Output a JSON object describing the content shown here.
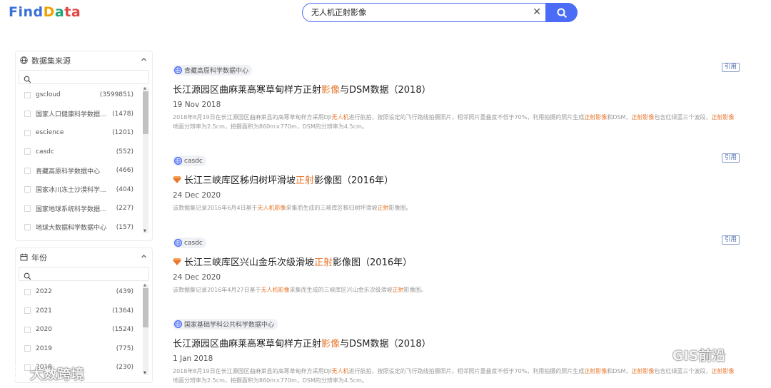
{
  "logo": {
    "part1": "Find",
    "part2": "D",
    "part3": "a",
    "part4": "ta"
  },
  "search": {
    "query": "无人机正射影像",
    "placeholder": ""
  },
  "sources_panel": {
    "title": "数据集来源",
    "items": [
      {
        "label": "gscloud",
        "count": "(3599851)"
      },
      {
        "label": "国家人口健康科学数据...",
        "count": "(1478)"
      },
      {
        "label": "escience",
        "count": "(1201)"
      },
      {
        "label": "casdc",
        "count": "(552)"
      },
      {
        "label": "青藏高原科学数据中心",
        "count": "(466)"
      },
      {
        "label": "国家冰川冻土沙漠科学...",
        "count": "(404)"
      },
      {
        "label": "国家地球系统科学数据...",
        "count": "(227)"
      },
      {
        "label": "地球大数据科学数据中心",
        "count": "(157)"
      }
    ]
  },
  "year_panel": {
    "title": "年份",
    "items": [
      {
        "label": "2022",
        "count": "(439)"
      },
      {
        "label": "2021",
        "count": "(1364)"
      },
      {
        "label": "2020",
        "count": "(1524)"
      },
      {
        "label": "2019",
        "count": "(775)"
      },
      {
        "label": "2018",
        "count": "(230)"
      }
    ]
  },
  "results": [
    {
      "source": "青藏高原科学数据中心",
      "cite": "引用",
      "title_pre": "长江源园区曲麻莱高寒草甸样方正射",
      "title_hl": "影像",
      "title_post": "与DSM数据（2018）",
      "date": "19 Nov 2018",
      "desc_1": "2018年8月19日在长江源园区曲麻莱县的高寒草甸样方采用DJI",
      "desc_hl1": "无人机",
      "desc_2": "进行航拍，按照设定的飞行路线拍摄照片，相邻照片重叠度不低于70%，利用拍摄的照片生成",
      "desc_hl2": "正射影像",
      "desc_3": "和DSM，",
      "desc_hl3": "正射影像",
      "desc_4": "包含红绿蓝三个波段，",
      "desc_hl4": "正射影像",
      "desc_5": "地面分辨率为2.5cm，拍摄面积为860m×770m，DSM的分辨率为4.5cm。"
    },
    {
      "source": "casdc",
      "cite": "引用",
      "title_pre": "长江三峡库区秭归树坪滑坡",
      "title_hl": "正射",
      "title_post": "影像图（2016年）",
      "date": "24 Dec 2020",
      "desc_1": "该数据集记录2016年6月4日基于",
      "desc_hl1": "无人机影像",
      "desc_2": "采集而生成的三峡库区秭归树坪滑坡",
      "desc_hl2": "正射",
      "desc_3": "影像图。"
    },
    {
      "source": "casdc",
      "cite": "引用",
      "title_pre": "长江三峡库区兴山金乐次级滑坡",
      "title_hl": "正射",
      "title_post": "影像图（2016年）",
      "date": "24 Dec 2020",
      "desc_1": "该数据集记录2016年4月27日基于",
      "desc_hl1": "无人机影像",
      "desc_2": "采集而生成的三峡库区兴山金乐次级滑坡",
      "desc_hl2": "正射",
      "desc_3": "影像图。"
    },
    {
      "source": "国家基础学科公共科学数据中心",
      "cite": "",
      "title_pre": "长江源园区曲麻莱高寒草甸样方正射",
      "title_hl": "影像",
      "title_post": "与DSM数据（2018）",
      "date": "1 Jan 2018",
      "desc_1": "2018年8月19日在长江源园区曲麻莱县的高寒草甸样方采用DJI",
      "desc_hl1": "无人机",
      "desc_2": "进行航拍，按照设定的飞行路线拍摄照片，相邻照片重叠度不低于70%，利用拍摄的照片生成",
      "desc_hl2": "正射影像",
      "desc_3": "和DSM，",
      "desc_hl3": "正射影像",
      "desc_4": "包含红绿蓝三个波段，",
      "desc_hl4": "正射影像",
      "desc_5": "地面分辨率为2.5cm，拍摄面积为860m×770m，DSM的分辨率为4.5cm。"
    }
  ],
  "watermarks": {
    "left": "大数跨境",
    "right": "GIS前沿"
  },
  "colors": {
    "accent": "#4a6cf7",
    "highlight": "#e8772e"
  }
}
